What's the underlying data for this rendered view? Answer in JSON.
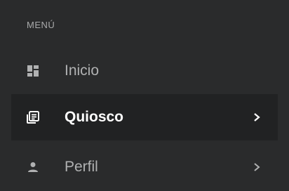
{
  "sidebar": {
    "header": "MENÚ",
    "items": [
      {
        "label": "Inicio",
        "icon": "dashboard-icon",
        "active": false,
        "has_chevron": false
      },
      {
        "label": "Quiosco",
        "icon": "newspaper-icon",
        "active": true,
        "has_chevron": true
      },
      {
        "label": "Perfil",
        "icon": "person-icon",
        "active": false,
        "has_chevron": true
      }
    ]
  },
  "colors": {
    "background": "#2a2b2c",
    "active_background": "#212223",
    "text_muted": "#b0b1b2",
    "text_active": "#ffffff",
    "header_text": "#a9aaab"
  }
}
